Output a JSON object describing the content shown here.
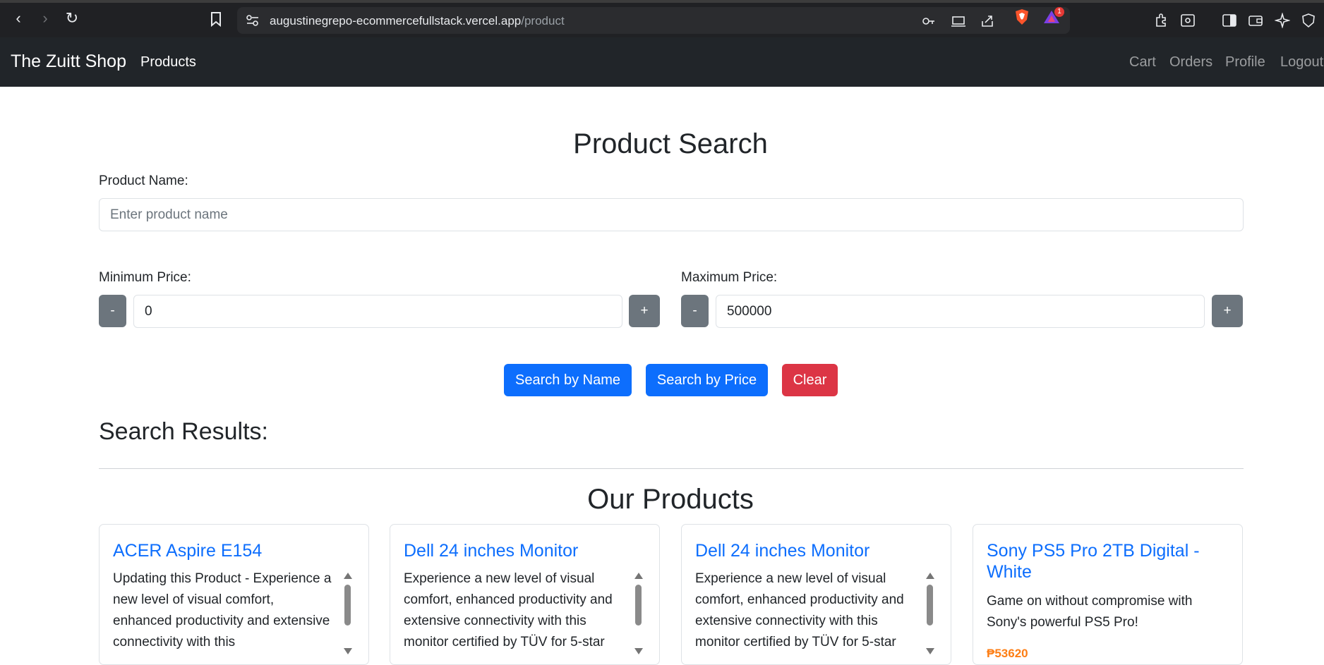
{
  "browser": {
    "url_host": "augustinegrepo-ecommercefullstack.vercel.app",
    "url_path": "/product",
    "rewards_badge": "1"
  },
  "navbar": {
    "brand": "The Zuitt Shop",
    "products": "Products",
    "cart": "Cart",
    "orders": "Orders",
    "profile": "Profile",
    "logout": "Logout"
  },
  "search": {
    "title": "Product Search",
    "name_label": "Product Name:",
    "name_placeholder": "Enter product name",
    "min_label": "Minimum Price:",
    "min_value": "0",
    "max_label": "Maximum Price:",
    "max_value": "500000",
    "minus": "-",
    "plus": "+",
    "search_name_button": "Search by Name",
    "search_price_button": "Search by Price",
    "clear_button": "Clear",
    "results_heading": "Search Results:"
  },
  "products": {
    "heading": "Our Products",
    "items": [
      {
        "name": "ACER Aspire E154",
        "description": "Updating this Product - Experience a new level of visual comfort, enhanced productivity and extensive connectivity with this"
      },
      {
        "name": "Dell 24 inches Monitor",
        "description": "Experience a new level of visual comfort, enhanced productivity and extensive connectivity with this monitor certified by TÜV for 5-star"
      },
      {
        "name": "Dell 24 inches Monitor",
        "description": "Experience a new level of visual comfort, enhanced productivity and extensive connectivity with this monitor certified by TÜV for 5-star"
      },
      {
        "name": "Sony PS5 Pro 2TB Digital - White",
        "description": "Game on without compromise with Sony's powerful PS5 Pro!",
        "price": "₱53620"
      }
    ]
  },
  "colors": {
    "primary": "#0d6efd",
    "danger": "#dc3545",
    "secondary": "#6c757d",
    "navbar": "#212529"
  }
}
